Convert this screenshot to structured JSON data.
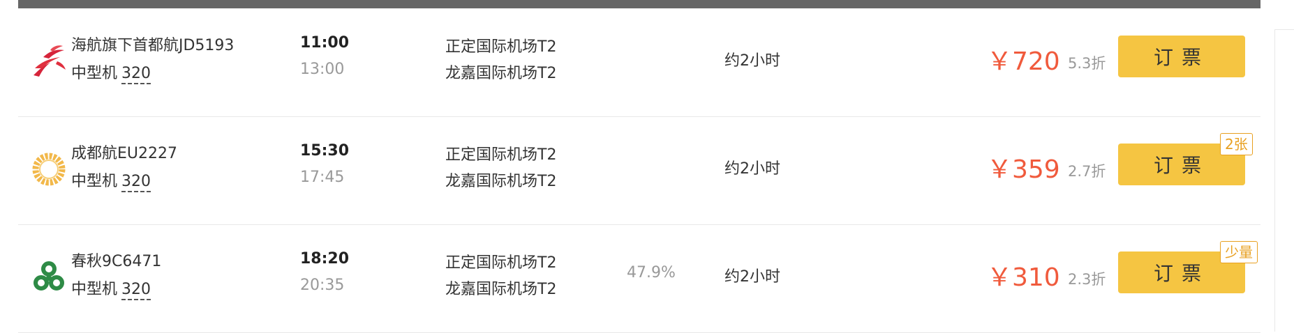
{
  "colors": {
    "top_bar": "#666666",
    "price": "#f05a3c",
    "book_button": "#f5c542",
    "badge": "#e8a020",
    "muted_text": "#999999"
  },
  "flights": [
    {
      "logo_icon": "hainan-airlines-logo-icon",
      "airline": "海航旗下首都航JD5193",
      "plane_type": "中型机",
      "plane_model": "320",
      "dep_time": "11:00",
      "arr_time": "13:00",
      "dep_airport": "正定国际机场T2",
      "arr_airport": "龙嘉国际机场T2",
      "rate": "",
      "duration": "约2小时",
      "price": "￥720",
      "discount": "5.3折",
      "book_label": "订票",
      "badge": ""
    },
    {
      "logo_icon": "chengdu-airlines-logo-icon",
      "airline": "成都航EU2227",
      "plane_type": "中型机",
      "plane_model": "320",
      "dep_time": "15:30",
      "arr_time": "17:45",
      "dep_airport": "正定国际机场T2",
      "arr_airport": "龙嘉国际机场T2",
      "rate": "",
      "duration": "约2小时",
      "price": "￥359",
      "discount": "2.7折",
      "book_label": "订票",
      "badge": "2张"
    },
    {
      "logo_icon": "spring-airlines-logo-icon",
      "airline": "春秋9C6471",
      "plane_type": "中型机",
      "plane_model": "320",
      "dep_time": "18:20",
      "arr_time": "20:35",
      "dep_airport": "正定国际机场T2",
      "arr_airport": "龙嘉国际机场T2",
      "rate": "47.9%",
      "duration": "约2小时",
      "price": "￥310",
      "discount": "2.3折",
      "book_label": "订票",
      "badge": "少量"
    }
  ]
}
